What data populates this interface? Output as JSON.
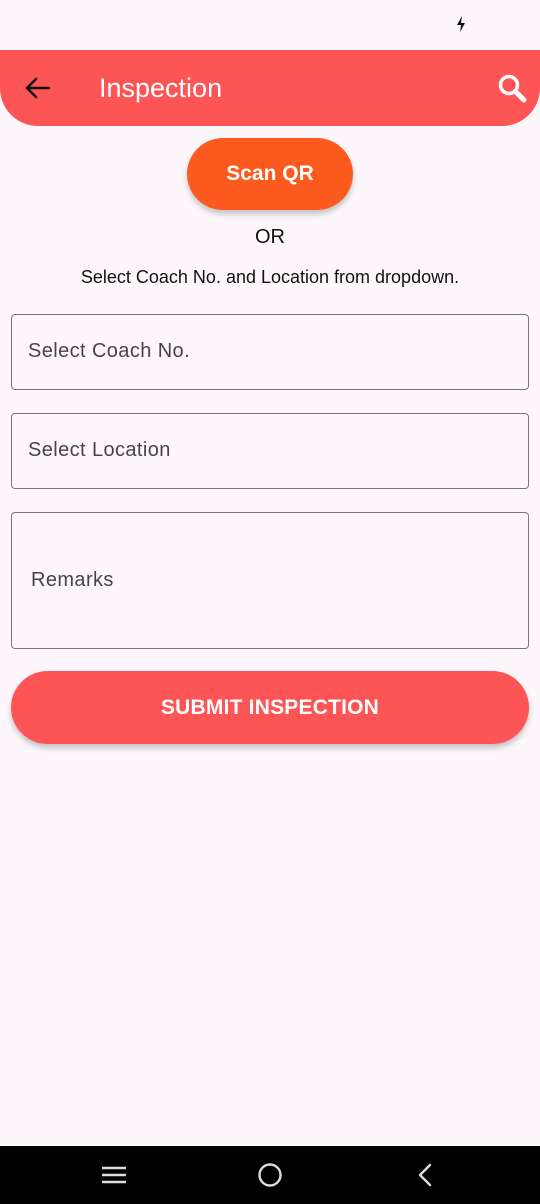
{
  "app_bar": {
    "title": "Inspection",
    "color": "#fd5456"
  },
  "scan": {
    "label": "Scan QR",
    "color": "#fd5a1f"
  },
  "divider_text": "OR",
  "hint": "Select Coach No. and Location from dropdown.",
  "form": {
    "coach_label": "Select Coach No.",
    "location_label": "Select Location",
    "remarks_label": "Remarks",
    "submit_label": "SUBMIT INSPECTION"
  },
  "icons": {
    "back": "arrow-left-icon",
    "search": "search-icon",
    "charging": "charging-bolt-icon",
    "nav_menu": "menu-lines-icon",
    "nav_home": "home-circle-icon",
    "nav_back": "chevron-left-icon"
  }
}
